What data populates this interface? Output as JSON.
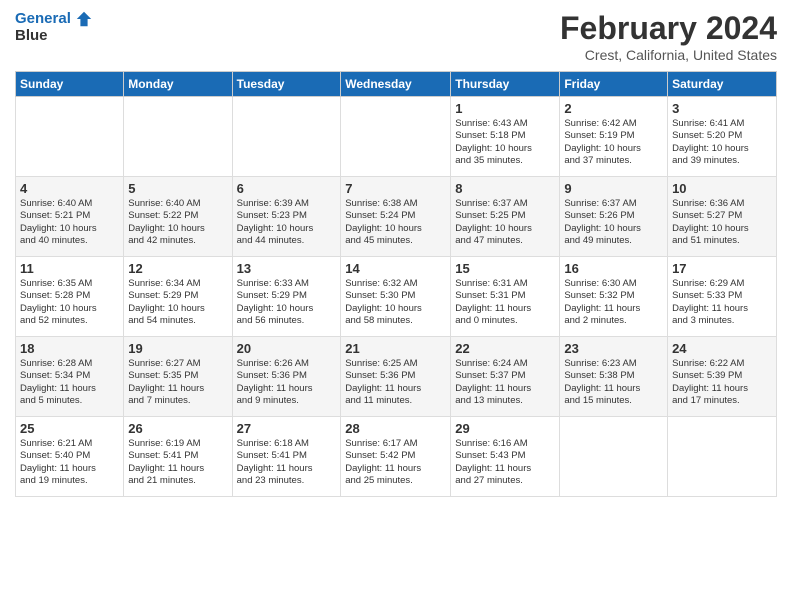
{
  "header": {
    "logo_text1": "General",
    "logo_text2": "Blue",
    "title": "February 2024",
    "subtitle": "Crest, California, United States"
  },
  "days_of_week": [
    "Sunday",
    "Monday",
    "Tuesday",
    "Wednesday",
    "Thursday",
    "Friday",
    "Saturday"
  ],
  "weeks": [
    [
      {
        "day": "",
        "info": ""
      },
      {
        "day": "",
        "info": ""
      },
      {
        "day": "",
        "info": ""
      },
      {
        "day": "",
        "info": ""
      },
      {
        "day": "1",
        "info": "Sunrise: 6:43 AM\nSunset: 5:18 PM\nDaylight: 10 hours\nand 35 minutes."
      },
      {
        "day": "2",
        "info": "Sunrise: 6:42 AM\nSunset: 5:19 PM\nDaylight: 10 hours\nand 37 minutes."
      },
      {
        "day": "3",
        "info": "Sunrise: 6:41 AM\nSunset: 5:20 PM\nDaylight: 10 hours\nand 39 minutes."
      }
    ],
    [
      {
        "day": "4",
        "info": "Sunrise: 6:40 AM\nSunset: 5:21 PM\nDaylight: 10 hours\nand 40 minutes."
      },
      {
        "day": "5",
        "info": "Sunrise: 6:40 AM\nSunset: 5:22 PM\nDaylight: 10 hours\nand 42 minutes."
      },
      {
        "day": "6",
        "info": "Sunrise: 6:39 AM\nSunset: 5:23 PM\nDaylight: 10 hours\nand 44 minutes."
      },
      {
        "day": "7",
        "info": "Sunrise: 6:38 AM\nSunset: 5:24 PM\nDaylight: 10 hours\nand 45 minutes."
      },
      {
        "day": "8",
        "info": "Sunrise: 6:37 AM\nSunset: 5:25 PM\nDaylight: 10 hours\nand 47 minutes."
      },
      {
        "day": "9",
        "info": "Sunrise: 6:37 AM\nSunset: 5:26 PM\nDaylight: 10 hours\nand 49 minutes."
      },
      {
        "day": "10",
        "info": "Sunrise: 6:36 AM\nSunset: 5:27 PM\nDaylight: 10 hours\nand 51 minutes."
      }
    ],
    [
      {
        "day": "11",
        "info": "Sunrise: 6:35 AM\nSunset: 5:28 PM\nDaylight: 10 hours\nand 52 minutes."
      },
      {
        "day": "12",
        "info": "Sunrise: 6:34 AM\nSunset: 5:29 PM\nDaylight: 10 hours\nand 54 minutes."
      },
      {
        "day": "13",
        "info": "Sunrise: 6:33 AM\nSunset: 5:29 PM\nDaylight: 10 hours\nand 56 minutes."
      },
      {
        "day": "14",
        "info": "Sunrise: 6:32 AM\nSunset: 5:30 PM\nDaylight: 10 hours\nand 58 minutes."
      },
      {
        "day": "15",
        "info": "Sunrise: 6:31 AM\nSunset: 5:31 PM\nDaylight: 11 hours\nand 0 minutes."
      },
      {
        "day": "16",
        "info": "Sunrise: 6:30 AM\nSunset: 5:32 PM\nDaylight: 11 hours\nand 2 minutes."
      },
      {
        "day": "17",
        "info": "Sunrise: 6:29 AM\nSunset: 5:33 PM\nDaylight: 11 hours\nand 3 minutes."
      }
    ],
    [
      {
        "day": "18",
        "info": "Sunrise: 6:28 AM\nSunset: 5:34 PM\nDaylight: 11 hours\nand 5 minutes."
      },
      {
        "day": "19",
        "info": "Sunrise: 6:27 AM\nSunset: 5:35 PM\nDaylight: 11 hours\nand 7 minutes."
      },
      {
        "day": "20",
        "info": "Sunrise: 6:26 AM\nSunset: 5:36 PM\nDaylight: 11 hours\nand 9 minutes."
      },
      {
        "day": "21",
        "info": "Sunrise: 6:25 AM\nSunset: 5:36 PM\nDaylight: 11 hours\nand 11 minutes."
      },
      {
        "day": "22",
        "info": "Sunrise: 6:24 AM\nSunset: 5:37 PM\nDaylight: 11 hours\nand 13 minutes."
      },
      {
        "day": "23",
        "info": "Sunrise: 6:23 AM\nSunset: 5:38 PM\nDaylight: 11 hours\nand 15 minutes."
      },
      {
        "day": "24",
        "info": "Sunrise: 6:22 AM\nSunset: 5:39 PM\nDaylight: 11 hours\nand 17 minutes."
      }
    ],
    [
      {
        "day": "25",
        "info": "Sunrise: 6:21 AM\nSunset: 5:40 PM\nDaylight: 11 hours\nand 19 minutes."
      },
      {
        "day": "26",
        "info": "Sunrise: 6:19 AM\nSunset: 5:41 PM\nDaylight: 11 hours\nand 21 minutes."
      },
      {
        "day": "27",
        "info": "Sunrise: 6:18 AM\nSunset: 5:41 PM\nDaylight: 11 hours\nand 23 minutes."
      },
      {
        "day": "28",
        "info": "Sunrise: 6:17 AM\nSunset: 5:42 PM\nDaylight: 11 hours\nand 25 minutes."
      },
      {
        "day": "29",
        "info": "Sunrise: 6:16 AM\nSunset: 5:43 PM\nDaylight: 11 hours\nand 27 minutes."
      },
      {
        "day": "",
        "info": ""
      },
      {
        "day": "",
        "info": ""
      }
    ]
  ]
}
